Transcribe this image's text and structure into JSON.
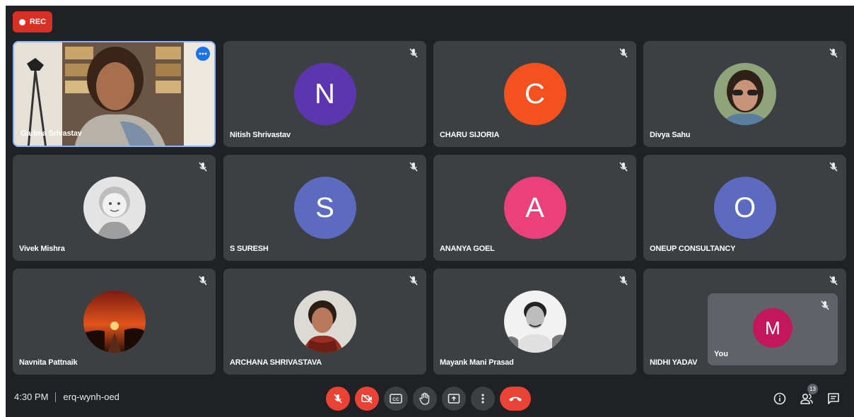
{
  "recording": {
    "label": "REC"
  },
  "participants": [
    {
      "name": "Garima Srivastav",
      "type": "video"
    },
    {
      "name": "Nitish Shrivastav",
      "initial": "N",
      "color": "#5e35b1"
    },
    {
      "name": "CHARU SIJORIA",
      "initial": "C",
      "color": "#f4511e"
    },
    {
      "name": "Divya Sahu",
      "type": "photo"
    },
    {
      "name": "Vivek Mishra",
      "type": "photo"
    },
    {
      "name": "S SURESH",
      "initial": "S",
      "color": "#5c6bc0"
    },
    {
      "name": "ANANYA GOEL",
      "initial": "A",
      "color": "#ec407a"
    },
    {
      "name": "ONEUP CONSULTANCY",
      "initial": "O",
      "color": "#5c6bc0"
    },
    {
      "name": "Navnita Pattnaik",
      "type": "photo"
    },
    {
      "name": "ARCHANA SHRIVASTAVA",
      "type": "photo"
    },
    {
      "name": "Mayank Mani Prasad",
      "type": "photo"
    },
    {
      "name": "NIDHI YADAV",
      "type": "hidden"
    }
  ],
  "self_view": {
    "name": "You",
    "initial": "M",
    "color": "#c2185b"
  },
  "meeting": {
    "time": "4:30 PM",
    "code": "erq-wynh-oed"
  },
  "people_count": "13",
  "icons": {
    "mic": "mic-off-icon",
    "camera": "camera-off-icon",
    "captions": "captions-icon",
    "hand": "raise-hand-icon",
    "present": "present-screen-icon",
    "more": "more-vert-icon",
    "hangup": "hang-up-icon",
    "info": "info-icon",
    "people": "people-icon",
    "chat": "chat-icon"
  }
}
